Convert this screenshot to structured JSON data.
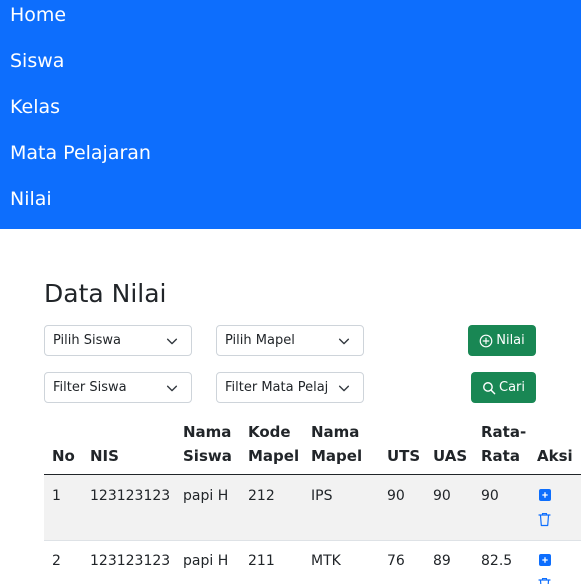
{
  "nav": {
    "items": [
      "Home",
      "Siswa",
      "Kelas",
      "Mata Pelajaran",
      "Nilai"
    ]
  },
  "page": {
    "title": "Data Nilai"
  },
  "form": {
    "select_siswa": "Pilih Siswa",
    "select_mapel": "Pilih Mapel",
    "add_button": "Nilai",
    "filter_siswa": "Filter Siswa",
    "filter_mapel": "Filter Mata Pelajaran",
    "search_button": "Cari"
  },
  "table": {
    "headers": {
      "no": "No",
      "nis": "NIS",
      "nama_siswa_1": "Nama",
      "nama_siswa_2": "Siswa",
      "kode_mapel_1": "Kode",
      "kode_mapel_2": "Mapel",
      "nama_mapel_1": "Nama",
      "nama_mapel_2": "Mapel",
      "uts": "UTS",
      "uas": "UAS",
      "rata_1": "Rata-",
      "rata_2": "Rata",
      "aksi": "Aksi"
    },
    "rows": [
      {
        "no": "1",
        "nis": "123123123",
        "nama": "papi H",
        "kode": "212",
        "mapel": "IPS",
        "uts": "90",
        "uas": "90",
        "rata": "90"
      },
      {
        "no": "2",
        "nis": "123123123",
        "nama": "papi H",
        "kode": "211",
        "mapel": "MTK",
        "uts": "76",
        "uas": "89",
        "rata": "82.5"
      }
    ]
  },
  "colors": {
    "navbar": "#0d6efd",
    "button_success": "#198754",
    "action_primary": "#0d6efd",
    "stripe": "#f2f2f2"
  }
}
